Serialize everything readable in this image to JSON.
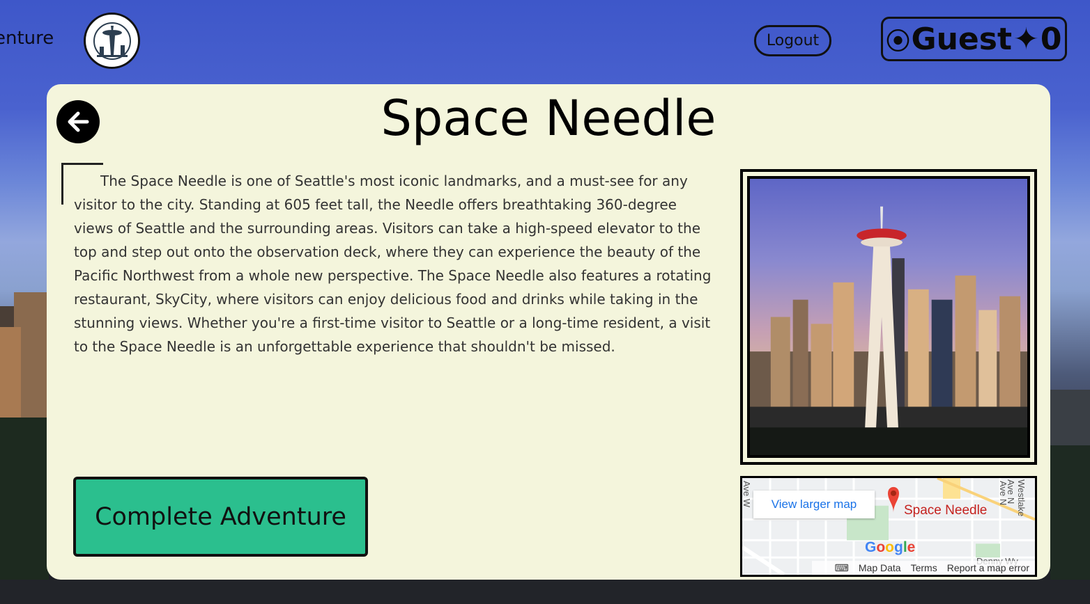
{
  "header": {
    "brand_text": "enture",
    "logout_label": "Logout",
    "user_label": "Guest",
    "user_points": "0",
    "user_radio_glyph": "⦿",
    "points_glyph": "✦"
  },
  "card": {
    "title": "Space Needle",
    "description": "The Space Needle is one of Seattle's most iconic landmarks, and a must-see for any visitor to the city. Standing at 605 feet tall, the Needle offers breathtaking 360-degree views of Seattle and the surrounding areas. Visitors can take a high-speed elevator to the top and step out onto the observation deck, where they can experience the beauty of the Pacific Northwest from a whole new perspective. The Space Needle also features a rotating restaurant, SkyCity, where visitors can enjoy delicious food and drinks while taking in the stunning views. Whether you're a first-time visitor to Seattle or a long-time resident, a visit to the Space Needle is an unforgettable experience that shouldn't be missed.",
    "complete_button": "Complete Adventure"
  },
  "map": {
    "view_larger": "View larger map",
    "place_name": "Space Needle",
    "google_logo": "Google",
    "footer": {
      "map_data": "Map Data",
      "terms": "Terms",
      "report": "Report a map error"
    },
    "streets": {
      "left": "Ave W",
      "right1": "Ave N",
      "right2": "Westlake Ave N",
      "bottom": "Denny Wy"
    }
  },
  "colors": {
    "card_bg": "#f4f5dc",
    "complete_button_bg": "#2bbf8e",
    "map_link": "#1a73e8",
    "map_pin": "#ea4335"
  }
}
